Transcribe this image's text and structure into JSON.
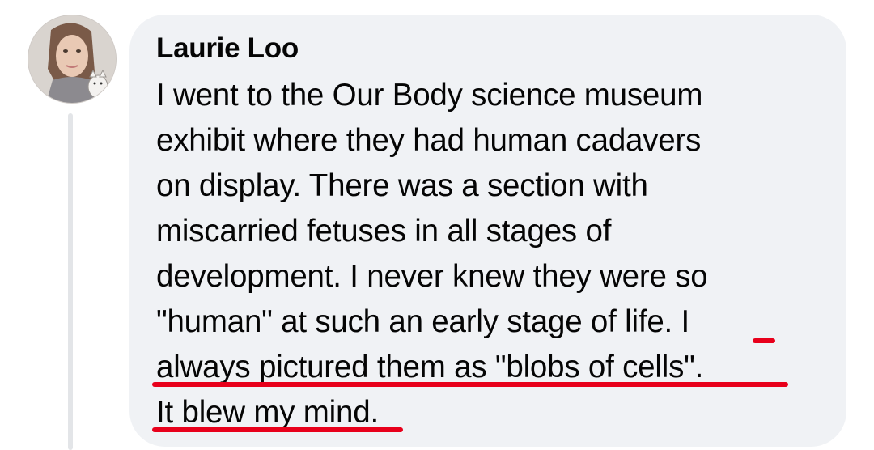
{
  "comment": {
    "author": "Laurie Loo",
    "lines": [
      "I went to the Our Body science museum",
      "exhibit where they had human cadavers",
      "on display. There was a section with",
      "miscarried fetuses in all stages of",
      "development. I never knew they were so"
    ],
    "line6_prefix": "\"human\" at such an early stage of life. ",
    "line6_highlight": "I",
    "line7_highlight": "always pictured them as \"blobs of cells\"",
    "line7_suffix": ".",
    "line8_highlight": "It blew my mind",
    "line8_suffix": ".",
    "highlight_color": "#e8001b"
  },
  "avatar": {
    "icon": "user-avatar-drawing"
  }
}
